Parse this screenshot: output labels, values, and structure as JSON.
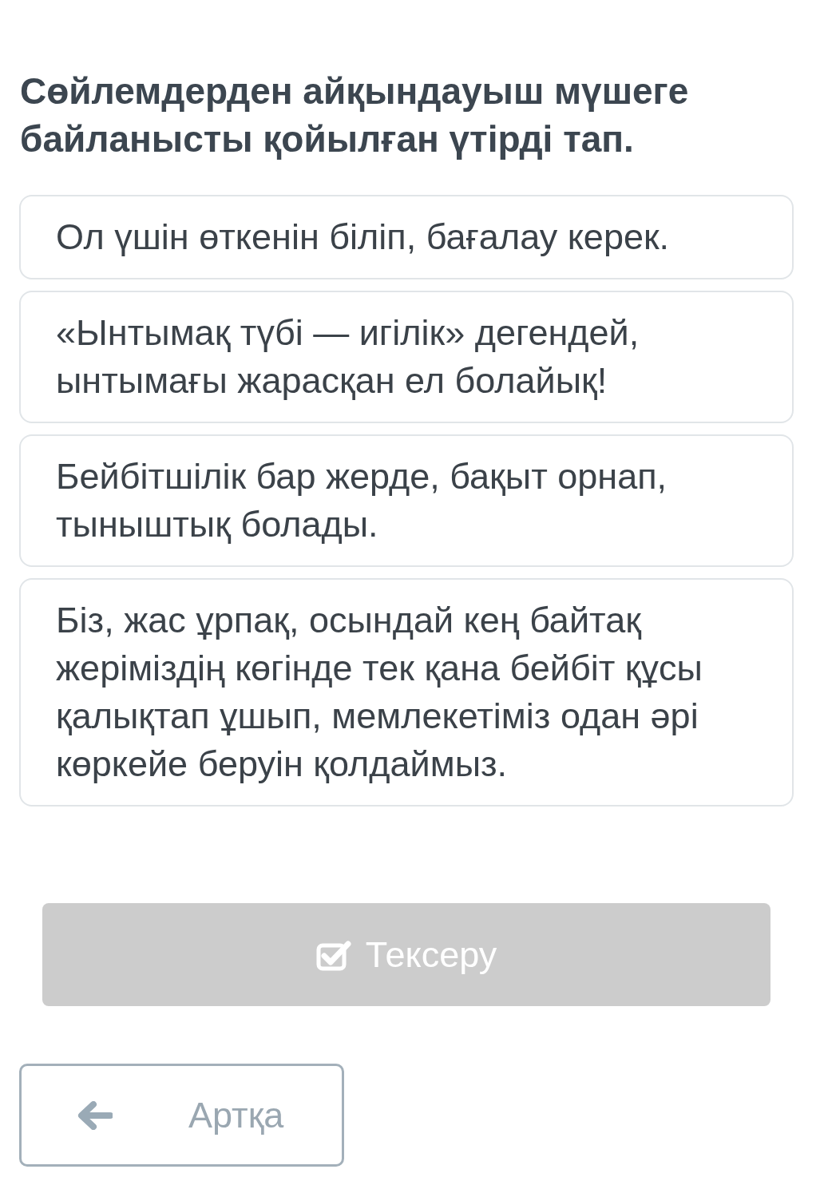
{
  "question": "Сөйлемдерден айқындауыш мүшеге байланысты қойылған үтірді тап.",
  "options": [
    {
      "text": "Ол үшін өткенін біліп, бағалау керек.",
      "selected": false
    },
    {
      "text": "«Ынтымақ түбі — игілік» дегендей, ынтымағы жарасқан ел болайық!",
      "selected": false
    },
    {
      "text": "Бейбітшілік бар жерде, бақыт орнап, тыныштық болады.",
      "selected": false
    },
    {
      "text": "Біз, жас ұрпақ, осындай кең байтақ жеріміздің көгінде тек қана бейбіт құсы қалықтап ұшып, мемлекетіміз одан әрі көркейе беруін қолдаймыз.",
      "selected": false
    }
  ],
  "check_button": {
    "label": "Тексеру",
    "disabled": true
  },
  "back_button": {
    "label": "Артқа"
  }
}
